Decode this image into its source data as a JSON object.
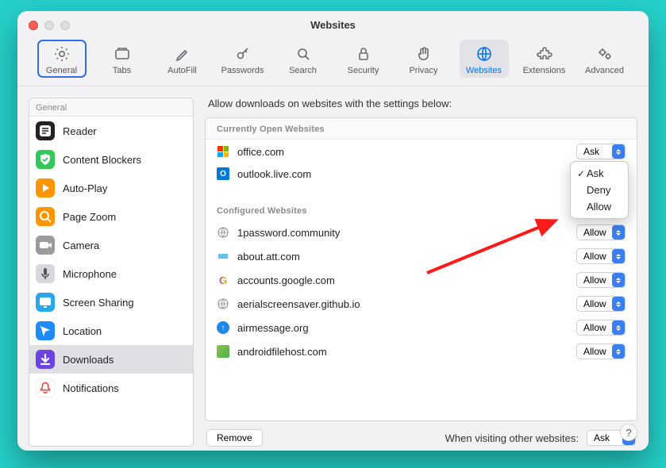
{
  "window": {
    "title": "Websites"
  },
  "toolbar": [
    {
      "id": "general",
      "label": "General"
    },
    {
      "id": "tabs",
      "label": "Tabs"
    },
    {
      "id": "autofill",
      "label": "AutoFill"
    },
    {
      "id": "passwords",
      "label": "Passwords"
    },
    {
      "id": "search",
      "label": "Search"
    },
    {
      "id": "security",
      "label": "Security"
    },
    {
      "id": "privacy",
      "label": "Privacy"
    },
    {
      "id": "websites",
      "label": "Websites"
    },
    {
      "id": "extensions",
      "label": "Extensions"
    },
    {
      "id": "advanced",
      "label": "Advanced"
    }
  ],
  "sidebar": {
    "header": "General",
    "items": [
      {
        "id": "reader",
        "label": "Reader",
        "color": "#222222",
        "glyph": "reader"
      },
      {
        "id": "contentBlockers",
        "label": "Content Blockers",
        "color": "#34c759",
        "glyph": "shield"
      },
      {
        "id": "autoPlay",
        "label": "Auto-Play",
        "color": "#ff9500",
        "glyph": "play"
      },
      {
        "id": "pageZoom",
        "label": "Page Zoom",
        "color": "#ff9500",
        "glyph": "zoom"
      },
      {
        "id": "camera",
        "label": "Camera",
        "color": "#9a9a9f",
        "glyph": "camera"
      },
      {
        "id": "microphone",
        "label": "Microphone",
        "color": "#d8d8dc",
        "glyph": "mic"
      },
      {
        "id": "screenSharing",
        "label": "Screen Sharing",
        "color": "#2aa7e8",
        "glyph": "screen"
      },
      {
        "id": "location",
        "label": "Location",
        "color": "#1f8bff",
        "glyph": "loc"
      },
      {
        "id": "downloads",
        "label": "Downloads",
        "color": "#6a43e0",
        "glyph": "down"
      },
      {
        "id": "notifications",
        "label": "Notifications",
        "color": "#ffffff",
        "glyph": "bell"
      }
    ],
    "selected": "downloads"
  },
  "main": {
    "heading": "Allow downloads on websites with the settings below:",
    "sections": {
      "open": {
        "label": "Currently Open Websites"
      },
      "configured": {
        "label": "Configured Websites"
      }
    },
    "openSites": [
      {
        "name": "office.com",
        "value": "Ask",
        "icon": "office"
      },
      {
        "name": "outlook.live.com",
        "value": "Ask",
        "icon": "outlook"
      }
    ],
    "configuredSites": [
      {
        "name": "1password.community",
        "value": "Allow",
        "icon": "globe"
      },
      {
        "name": "about.att.com",
        "value": "Allow",
        "icon": "att"
      },
      {
        "name": "accounts.google.com",
        "value": "Allow",
        "icon": "google"
      },
      {
        "name": "aerialscreensaver.github.io",
        "value": "Allow",
        "icon": "globe"
      },
      {
        "name": "airmessage.org",
        "value": "Allow",
        "icon": "airmsg"
      },
      {
        "name": "androidfilehost.com",
        "value": "Allow",
        "icon": "afh"
      }
    ],
    "dropdown": {
      "options": [
        "Ask",
        "Deny",
        "Allow"
      ],
      "selected": "Ask"
    },
    "remove_label": "Remove",
    "footer_label": "When visiting other websites:",
    "footer_value": "Ask"
  }
}
